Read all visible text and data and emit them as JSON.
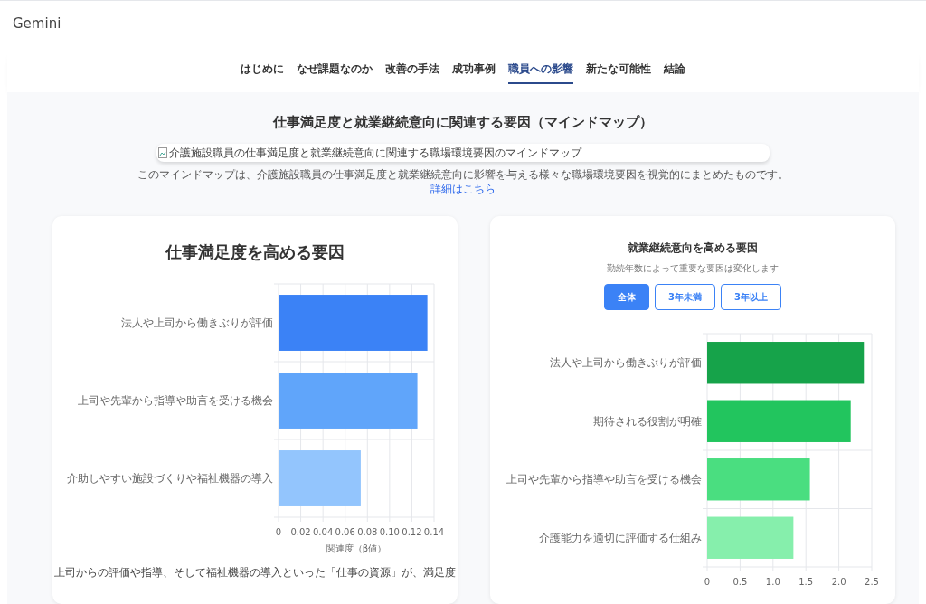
{
  "app": {
    "title": "Gemini"
  },
  "nav": {
    "tabs": [
      {
        "label": "はじめに",
        "selected": false
      },
      {
        "label": "なぜ課題なのか",
        "selected": false
      },
      {
        "label": "改善の手法",
        "selected": false
      },
      {
        "label": "成功事例",
        "selected": false
      },
      {
        "label": "職員への影響",
        "selected": true
      },
      {
        "label": "新たな可能性",
        "selected": false
      },
      {
        "label": "結論",
        "selected": false
      }
    ]
  },
  "mindmap": {
    "title": "仕事満足度と就業継続意向に関連する要因（マインドマップ）",
    "image_alt": "介護施設職員の仕事満足度と就業継続意向に関連する職場環境要因のマインドマップ",
    "caption": "このマインドマップは、介護施設職員の仕事満足度と就業継続意向に影響を与える様々な職場環境要因を視覚的にまとめたものです。",
    "link": "詳細はこちら"
  },
  "satisfaction": {
    "title": "仕事満足度を高める要因",
    "chart_data": {
      "type": "bar",
      "orientation": "horizontal",
      "grid": true,
      "xlabel": "関連度（β値）",
      "categories": [
        "法人や上司から働きぶりが評価",
        "上司や先輩から指導や助言を受ける機会",
        "介助しやすい施設づくりや福祉機器の導入"
      ],
      "values": [
        0.134,
        0.125,
        0.074
      ],
      "xlim": [
        0,
        0.14
      ],
      "xticks": [
        0,
        0.02,
        0.04,
        0.06,
        0.08,
        {
          "value": 0.1,
          "label": "0.10"
        },
        0.12,
        0.14
      ]
    },
    "summary": "上司からの評価や指導、そして福祉機器の導入といった「仕事の資源」が、満足度"
  },
  "retention": {
    "title": "就業継続意向を高める要因",
    "subtitle": "勤続年数によって重要な要因は変化します",
    "filters": [
      {
        "label": "全体",
        "selected": true
      },
      {
        "label": "3年未満",
        "selected": false
      },
      {
        "label": "3年以上",
        "selected": false
      }
    ],
    "chart_data": {
      "type": "bar",
      "orientation": "horizontal",
      "grid": true,
      "categories": [
        "法人や上司から働きぶりが評価",
        "期待される役割が明確",
        "上司や先輩から指導や助言を受ける機会",
        "介護能力を適切に評価する仕組み"
      ],
      "values": [
        2.38,
        2.18,
        1.56,
        1.31
      ],
      "xlim": [
        0,
        2.5
      ],
      "xticks": [
        0,
        0.5,
        {
          "value": 1,
          "label": "1.0"
        },
        1.5,
        {
          "value": 2,
          "label": "2.0"
        },
        2.5
      ]
    }
  }
}
